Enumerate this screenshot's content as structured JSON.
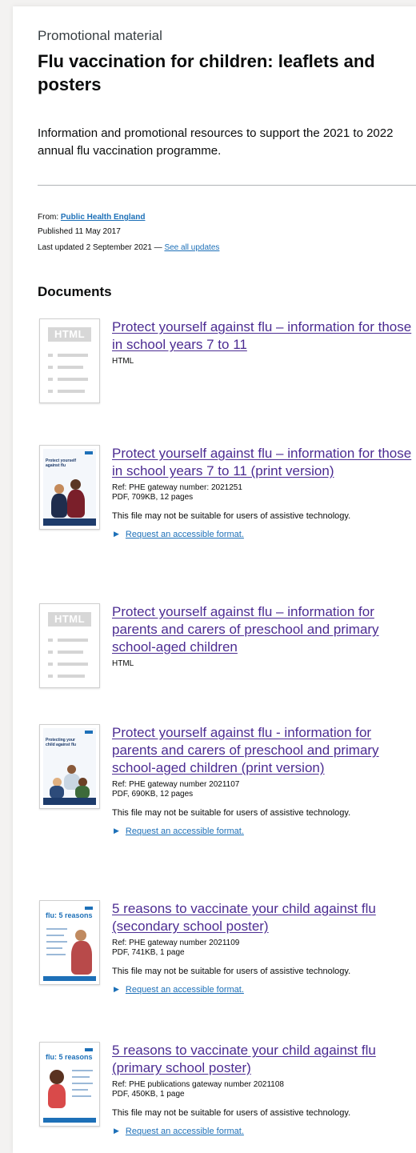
{
  "header": {
    "caption": "Promotional material",
    "title": "Flu vaccination for children: leaflets and posters",
    "description": "Information and promotional resources to support the 2021 to 2022 annual flu vaccination programme."
  },
  "meta": {
    "from_label": "From:",
    "from_org": "Public Health England",
    "published": "Published 11 May 2017",
    "updated": "Last updated 2 September 2021 —",
    "see_updates": "See all updates"
  },
  "documents_heading": "Documents",
  "documents": [
    {
      "title": "Protect yourself against flu – information for those in school years 7 to 11",
      "format": "HTML"
    },
    {
      "title": "Protect yourself against flu – information for those in school years 7 to 11 (print version)",
      "ref": "Ref: PHE gateway number: 2021251",
      "format": "PDF, 709KB, 12 pages",
      "cover_title": "Protect yourself against flu",
      "note": "This file may not be suitable for users of assistive technology.",
      "request": "Request an accessible format."
    },
    {
      "title": "Protect yourself against flu – information for parents and carers of preschool and primary school-aged children",
      "format": "HTML"
    },
    {
      "title": "Protect yourself against flu - information for parents and carers of preschool and primary school-aged children (print version)",
      "ref": "Ref: PHE gateway number 2021107",
      "format": "PDF, 690KB, 12 pages",
      "cover_title": "Protecting your child against flu",
      "note": "This file may not be suitable for users of assistive technology.",
      "request": "Request an accessible format."
    },
    {
      "title": "5 reasons to vaccinate your child against flu (secondary school poster)",
      "ref": "Ref: PHE gateway number 2021109",
      "format": "PDF, 741KB, 1 page",
      "cover_title": "flu: 5 reasons",
      "note": "This file may not be suitable for users of assistive technology.",
      "request": "Request an accessible format."
    },
    {
      "title": "5 reasons to vaccinate your child against flu (primary school poster)",
      "ref": "Ref: PHE publications gateway number 2021108",
      "format": "PDF, 450KB, 1 page",
      "cover_title": "flu: 5 reasons",
      "note": "This file may not be suitable for users of assistive technology.",
      "request": "Request an accessible format."
    }
  ],
  "thumbnail_label": "HTML",
  "colors": {
    "link": "#1d70b8",
    "visited_link": "#4c2c92",
    "text": "#0b0c0c",
    "rule": "#b1b4b6"
  }
}
